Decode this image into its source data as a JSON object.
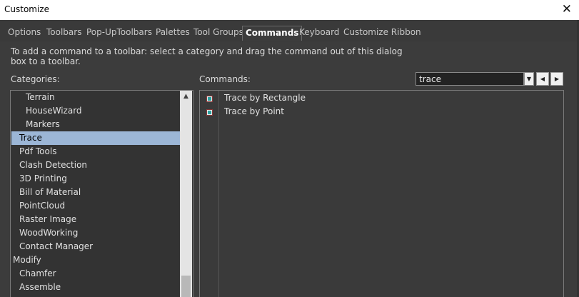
{
  "window": {
    "title": "Customize",
    "close_glyph": "✕"
  },
  "tabs": [
    {
      "label": "Options",
      "active": false
    },
    {
      "label": "Toolbars",
      "active": false
    },
    {
      "label": "Pop-UpToolbars",
      "active": false
    },
    {
      "label": "Palettes",
      "active": false
    },
    {
      "label": "Tool Groups",
      "active": false
    },
    {
      "label": "Commands",
      "active": true
    },
    {
      "label": "Keyboard",
      "active": false
    },
    {
      "label": "Customize Ribbon",
      "active": false
    }
  ],
  "instructions": "To add a command to a toolbar: select a category and drag the command out of this dialog box to a toolbar.",
  "categories": {
    "label": "Categories:",
    "items": [
      {
        "label": "Terrain",
        "indent": 2,
        "selected": false
      },
      {
        "label": "HouseWizard",
        "indent": 2,
        "selected": false
      },
      {
        "label": "Markers",
        "indent": 2,
        "selected": false
      },
      {
        "label": "Trace",
        "indent": 1,
        "selected": true
      },
      {
        "label": "Pdf Tools",
        "indent": 1,
        "selected": false
      },
      {
        "label": "Clash Detection",
        "indent": 1,
        "selected": false
      },
      {
        "label": "3D Printing",
        "indent": 1,
        "selected": false
      },
      {
        "label": "Bill of Material",
        "indent": 1,
        "selected": false
      },
      {
        "label": "PointCloud",
        "indent": 1,
        "selected": false
      },
      {
        "label": "Raster Image",
        "indent": 1,
        "selected": false
      },
      {
        "label": "WoodWorking",
        "indent": 1,
        "selected": false
      },
      {
        "label": "Contact Manager",
        "indent": 1,
        "selected": false
      },
      {
        "label": "Modify",
        "indent": 0,
        "selected": false
      },
      {
        "label": "Chamfer",
        "indent": 1,
        "selected": false
      },
      {
        "label": "Assemble",
        "indent": 1,
        "selected": false
      }
    ]
  },
  "commands": {
    "label": "Commands:",
    "search_value": "trace",
    "items": [
      {
        "label": "Trace by Rectangle",
        "icon": "trace-rectangle-icon"
      },
      {
        "label": "Trace by Point",
        "icon": "trace-point-icon"
      }
    ]
  },
  "glyphs": {
    "dropdown": "▼",
    "prev": "◀",
    "next": "▶",
    "scroll_up": "▲"
  }
}
